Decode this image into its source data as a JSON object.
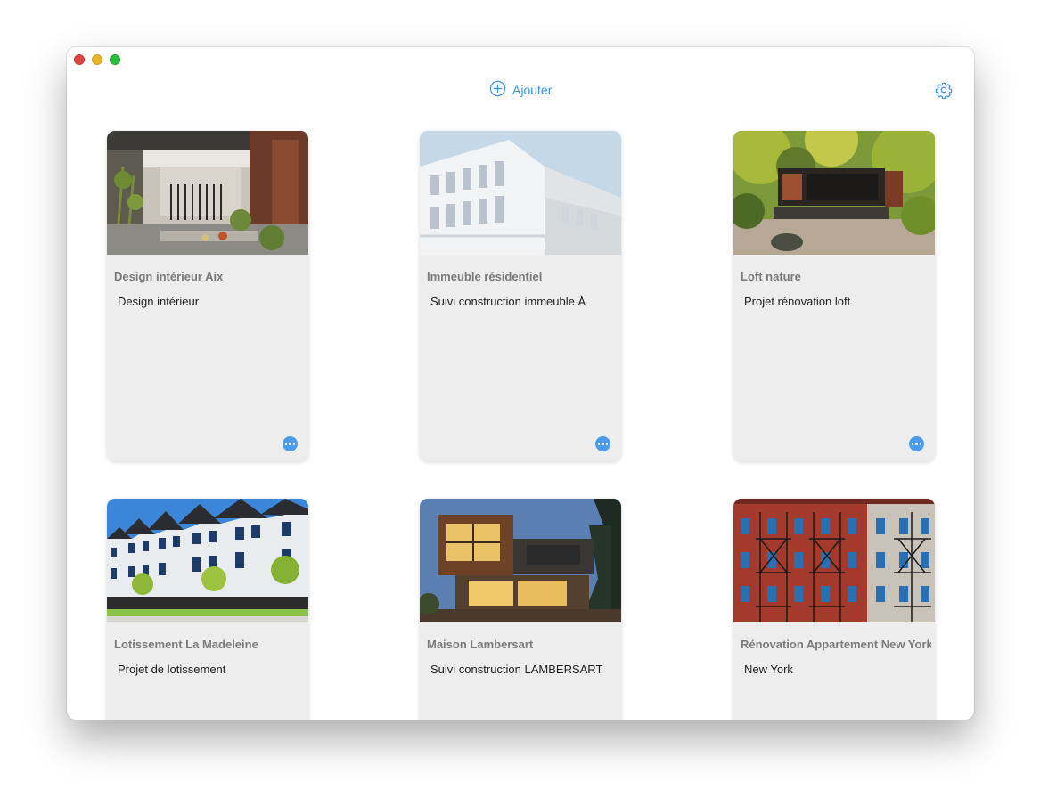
{
  "toolbar": {
    "add_label": "Ajouter",
    "add_icon": "plus-circle-icon",
    "settings_icon": "gear-icon",
    "accent_color": "#3d8fe0"
  },
  "window_controls": [
    "close",
    "minimize",
    "zoom"
  ],
  "projects": [
    {
      "title": "Design intérieur Aix",
      "description": "Design intérieur",
      "image": "interior-atrium-photo",
      "has_menu": true
    },
    {
      "title": "Immeuble résidentiel",
      "description": "Suivi construction immeuble À",
      "image": "white-apartment-building-photo",
      "has_menu": true
    },
    {
      "title": "Loft nature",
      "description": "Projet rénovation loft",
      "image": "forest-loft-photo",
      "has_menu": true
    },
    {
      "title": "Lotissement La Madeleine",
      "description": "Projet de lotissement",
      "image": "townhouses-photo",
      "has_menu": false
    },
    {
      "title": "Maison Lambersart",
      "description": "Suivi construction LAMBERSART",
      "image": "modern-wood-house-photo",
      "has_menu": false
    },
    {
      "title": "Rénovation Appartement New York",
      "description": "New York",
      "image": "brick-facade-photo",
      "has_menu": false
    }
  ]
}
